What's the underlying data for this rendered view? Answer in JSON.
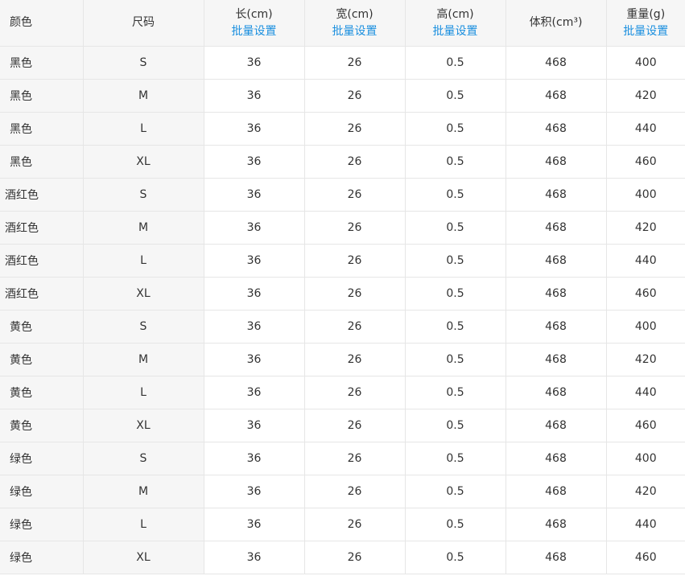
{
  "table": {
    "headers": {
      "color": "颜色",
      "size": "尺码",
      "length": "长(cm)",
      "width": "宽(cm)",
      "height": "高(cm)",
      "volume": "体积(cm³)",
      "weight": "重量(g)",
      "bulk_set": "批量设置"
    },
    "rows": [
      {
        "color": "黑色",
        "size": "S",
        "length": "36",
        "width": "26",
        "height": "0.5",
        "volume": "468",
        "weight": "400"
      },
      {
        "color": "黑色",
        "size": "M",
        "length": "36",
        "width": "26",
        "height": "0.5",
        "volume": "468",
        "weight": "420"
      },
      {
        "color": "黑色",
        "size": "L",
        "length": "36",
        "width": "26",
        "height": "0.5",
        "volume": "468",
        "weight": "440"
      },
      {
        "color": "黑色",
        "size": "XL",
        "length": "36",
        "width": "26",
        "height": "0.5",
        "volume": "468",
        "weight": "460"
      },
      {
        "color": "酒红色",
        "size": "S",
        "length": "36",
        "width": "26",
        "height": "0.5",
        "volume": "468",
        "weight": "400"
      },
      {
        "color": "酒红色",
        "size": "M",
        "length": "36",
        "width": "26",
        "height": "0.5",
        "volume": "468",
        "weight": "420"
      },
      {
        "color": "酒红色",
        "size": "L",
        "length": "36",
        "width": "26",
        "height": "0.5",
        "volume": "468",
        "weight": "440"
      },
      {
        "color": "酒红色",
        "size": "XL",
        "length": "36",
        "width": "26",
        "height": "0.5",
        "volume": "468",
        "weight": "460"
      },
      {
        "color": "黄色",
        "size": "S",
        "length": "36",
        "width": "26",
        "height": "0.5",
        "volume": "468",
        "weight": "400"
      },
      {
        "color": "黄色",
        "size": "M",
        "length": "36",
        "width": "26",
        "height": "0.5",
        "volume": "468",
        "weight": "420"
      },
      {
        "color": "黄色",
        "size": "L",
        "length": "36",
        "width": "26",
        "height": "0.5",
        "volume": "468",
        "weight": "440"
      },
      {
        "color": "黄色",
        "size": "XL",
        "length": "36",
        "width": "26",
        "height": "0.5",
        "volume": "468",
        "weight": "460"
      },
      {
        "color": "绿色",
        "size": "S",
        "length": "36",
        "width": "26",
        "height": "0.5",
        "volume": "468",
        "weight": "400"
      },
      {
        "color": "绿色",
        "size": "M",
        "length": "36",
        "width": "26",
        "height": "0.5",
        "volume": "468",
        "weight": "420"
      },
      {
        "color": "绿色",
        "size": "L",
        "length": "36",
        "width": "26",
        "height": "0.5",
        "volume": "468",
        "weight": "440"
      },
      {
        "color": "绿色",
        "size": "XL",
        "length": "36",
        "width": "26",
        "height": "0.5",
        "volume": "468",
        "weight": "460"
      }
    ]
  }
}
